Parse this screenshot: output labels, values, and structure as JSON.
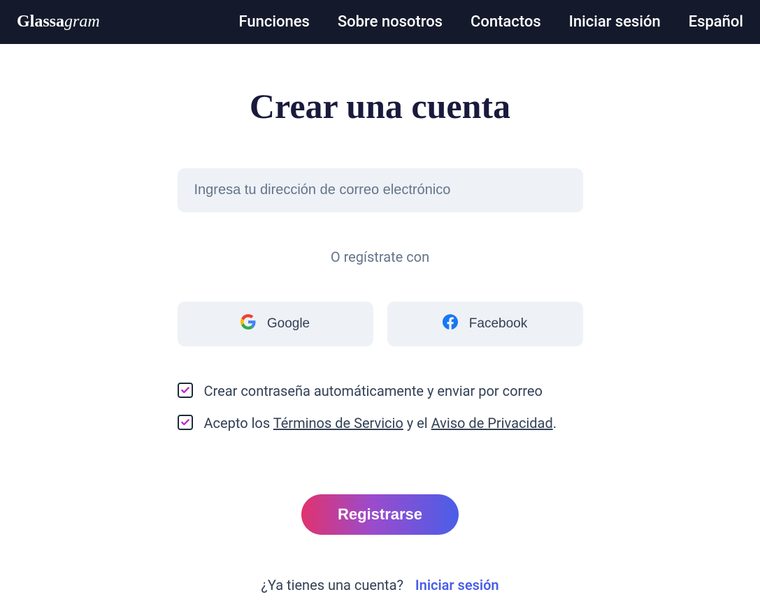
{
  "brand": {
    "part1": "Glassa",
    "part2": "gram"
  },
  "nav": {
    "features": "Funciones",
    "about": "Sobre nosotros",
    "contacts": "Contactos",
    "login": "Iniciar sesión",
    "language": "Español"
  },
  "page": {
    "title": "Crear una cuenta",
    "emailPlaceholder": "Ingresa tu dirección de correo electrónico",
    "divider": "O regístrate con",
    "googleLabel": "Google",
    "facebookLabel": "Facebook"
  },
  "checks": {
    "autoPassword": "Crear contraseña automáticamente y enviar por correo",
    "termsPrefix": "Acepto los ",
    "termsLink": "Términos de Servicio",
    "termsMid": " y el ",
    "privacyLink": "Aviso de Privacidad",
    "termsSuffix": "."
  },
  "submit": {
    "label": "Registrarse"
  },
  "footer": {
    "question": "¿Ya tienes una cuenta?",
    "login": "Iniciar sesión"
  }
}
